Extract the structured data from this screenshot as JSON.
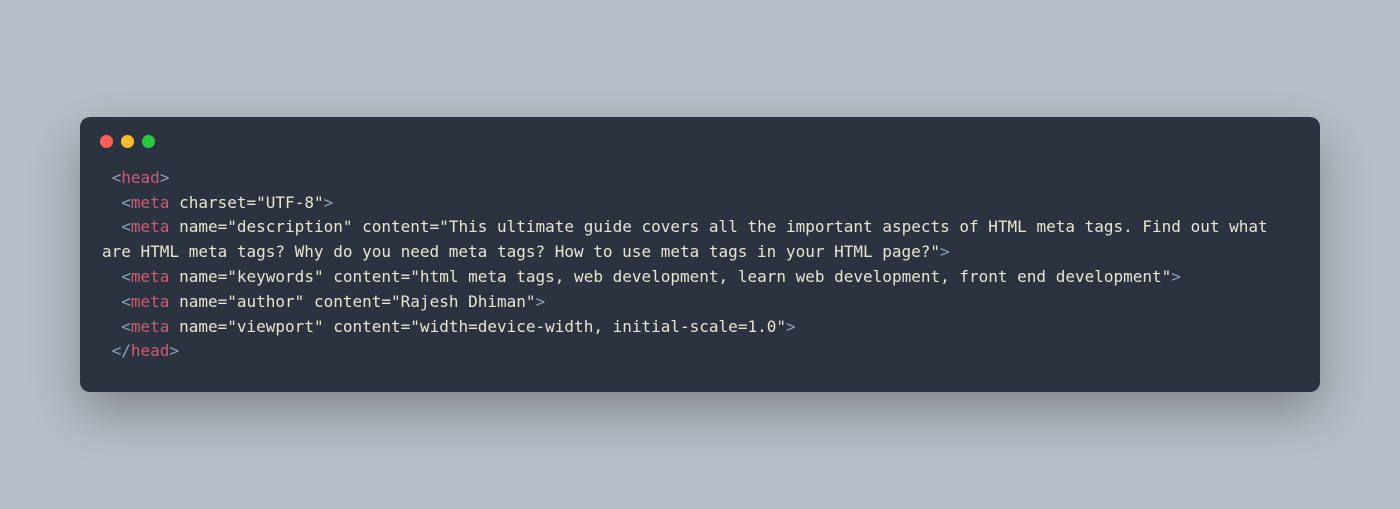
{
  "window": {
    "controls": {
      "close": "red",
      "minimize": "yellow",
      "maximize": "green"
    }
  },
  "code": {
    "l1": {
      "open": " <",
      "tag": "head",
      "close": ">"
    },
    "l2": {
      "open": "  <",
      "tag": "meta",
      "sp": " ",
      "attr": "charset",
      "eq": "=",
      "val": "\"UTF-8\"",
      "close": ">"
    },
    "l3": {
      "open": "  <",
      "tag": "meta",
      "sp": " ",
      "attr1": "name",
      "eq1": "=",
      "val1": "\"description\"",
      "sp2": " ",
      "attr2": "content",
      "eq2": "=",
      "val2": "\"This ultimate guide covers all the important aspects of HTML meta tags. Find out what are HTML meta tags? Why do you need meta tags? How to use meta tags in your HTML page?\"",
      "close": ">"
    },
    "l4": {
      "open": "  <",
      "tag": "meta",
      "sp": " ",
      "attr1": "name",
      "eq1": "=",
      "val1": "\"keywords\"",
      "sp2": " ",
      "attr2": "content",
      "eq2": "=",
      "val2": "\"html meta tags, web development, learn web development, front end development\"",
      "close": ">"
    },
    "l5": {
      "open": "  <",
      "tag": "meta",
      "sp": " ",
      "attr1": "name",
      "eq1": "=",
      "val1": "\"author\"",
      "sp2": " ",
      "attr2": "content",
      "eq2": "=",
      "val2": "\"Rajesh Dhiman\"",
      "close": ">"
    },
    "l6": {
      "open": "  <",
      "tag": "meta",
      "sp": " ",
      "attr1": "name",
      "eq1": "=",
      "val1": "\"viewport\"",
      "sp2": " ",
      "attr2": "content",
      "eq2": "=",
      "val2": "\"width=device-width, initial-scale=1.0\"",
      "close": ">"
    },
    "l7": {
      "open": " </",
      "tag": "head",
      "close": ">"
    }
  }
}
